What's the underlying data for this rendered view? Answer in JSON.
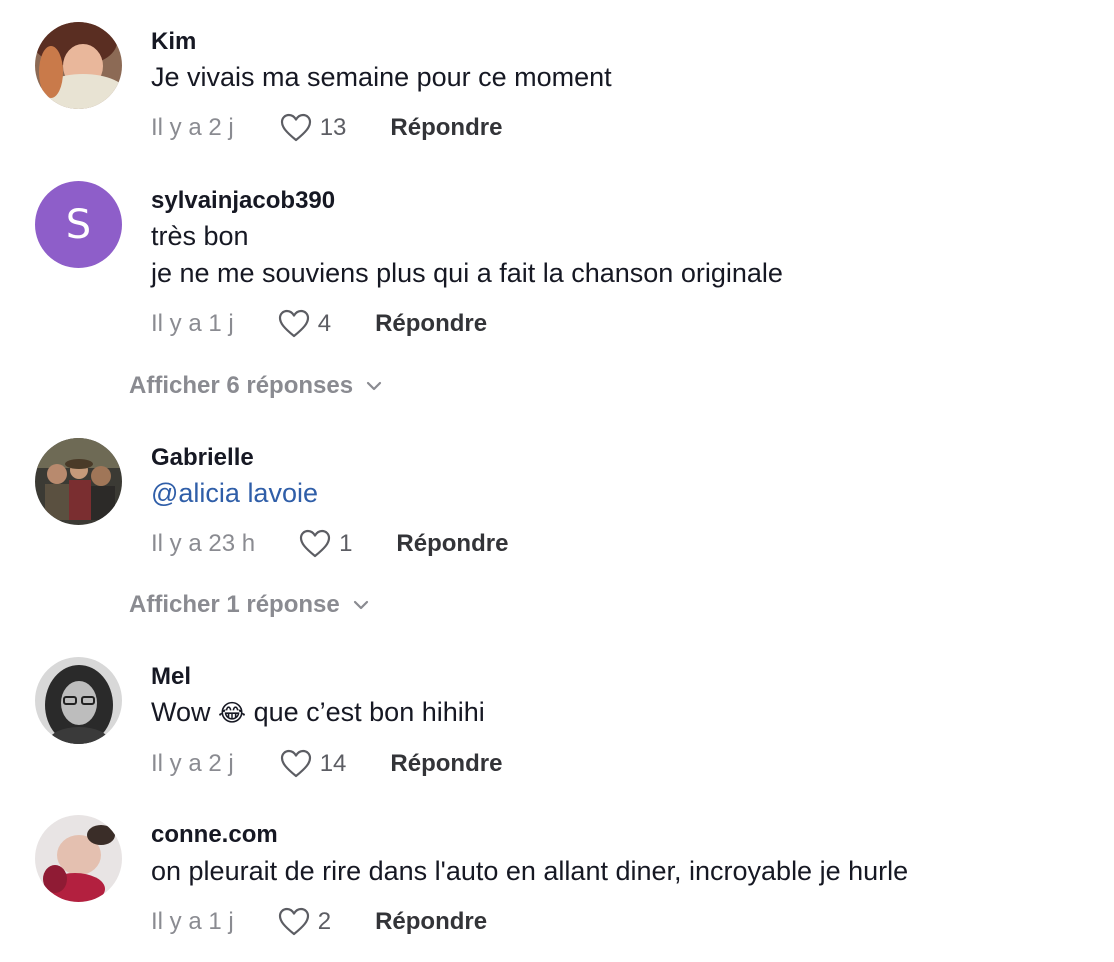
{
  "comments": [
    {
      "username": "Kim",
      "lines": [
        "Je vivais ma semaine pour ce moment"
      ],
      "time": "Il y a 2 j",
      "likes": "13",
      "reply_label": "Répondre"
    },
    {
      "username": "sylvainjacob390",
      "avatar_letter": "S",
      "lines": [
        "très bon",
        "je ne me souviens plus qui a fait la chanson originale"
      ],
      "time": "Il y a 1 j",
      "likes": "4",
      "reply_label": "Répondre",
      "show_replies": "Afficher 6 réponses"
    },
    {
      "username": "Gabrielle",
      "mention": "@alicia lavoie",
      "time": "Il y a 23 h",
      "likes": "1",
      "reply_label": "Répondre",
      "show_replies": "Afficher 1 réponse"
    },
    {
      "username": "Mel",
      "text_before_emoji": "Wow",
      "emoji": "😂",
      "text_after_emoji": "que c’est bon hihihi",
      "time": "Il y a 2 j",
      "likes": "14",
      "reply_label": "Répondre"
    },
    {
      "username": "conne.com",
      "lines": [
        "on pleurait de rire dans l'auto en allant diner, incroyable je hurle"
      ],
      "time": "Il y a 1 j",
      "likes": "2",
      "reply_label": "Répondre"
    }
  ],
  "colors": {
    "mention": "#2f5ea8",
    "muted": "#8a8b91",
    "avatar_letter_bg": "#8e5ec9"
  }
}
